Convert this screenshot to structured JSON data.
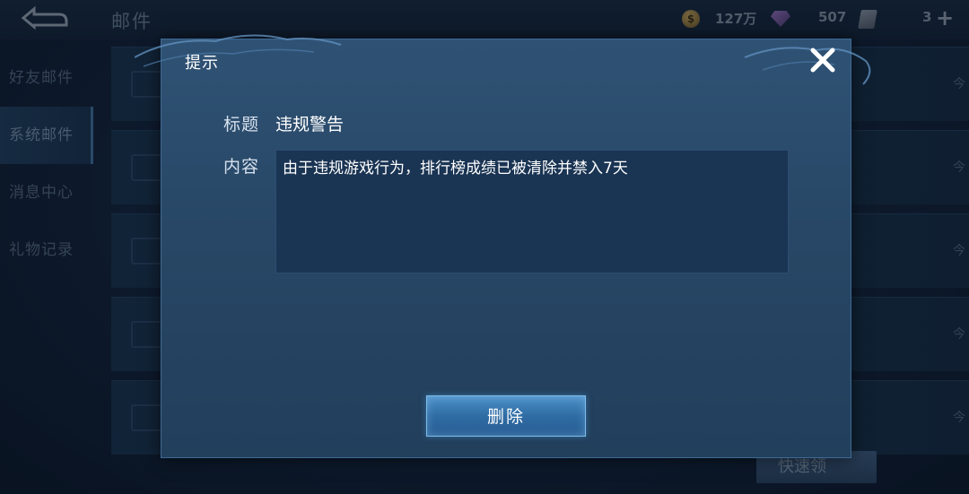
{
  "background": {
    "page_title": "邮件",
    "resources": {
      "coin_amount": "127万",
      "gem_amount": "507",
      "ticket_amount": "3"
    },
    "sidebar": {
      "items": [
        {
          "label": "好友邮件",
          "active": false
        },
        {
          "label": "系统邮件",
          "active": true
        },
        {
          "label": "消息中心",
          "active": false
        },
        {
          "label": "礼物记录",
          "active": false
        }
      ]
    },
    "mail_rows": [
      {
        "date": "今"
      },
      {
        "date": "今"
      },
      {
        "date": "今"
      },
      {
        "date": "今"
      },
      {
        "date": "今"
      }
    ],
    "quick_button_label": "快速领"
  },
  "dialog": {
    "title": "提示",
    "subject_label": "标题",
    "subject_value": "违规警告",
    "content_label": "内容",
    "content_value": "由于违规游戏行为，排行榜成绩已被清除并禁入7天",
    "delete_button_label": "删除",
    "close_icon": "close-icon"
  },
  "colors": {
    "dialog_bg": "#2a4a6a",
    "button_accent": "#3a7cb8",
    "text_primary": "#ffffff"
  }
}
